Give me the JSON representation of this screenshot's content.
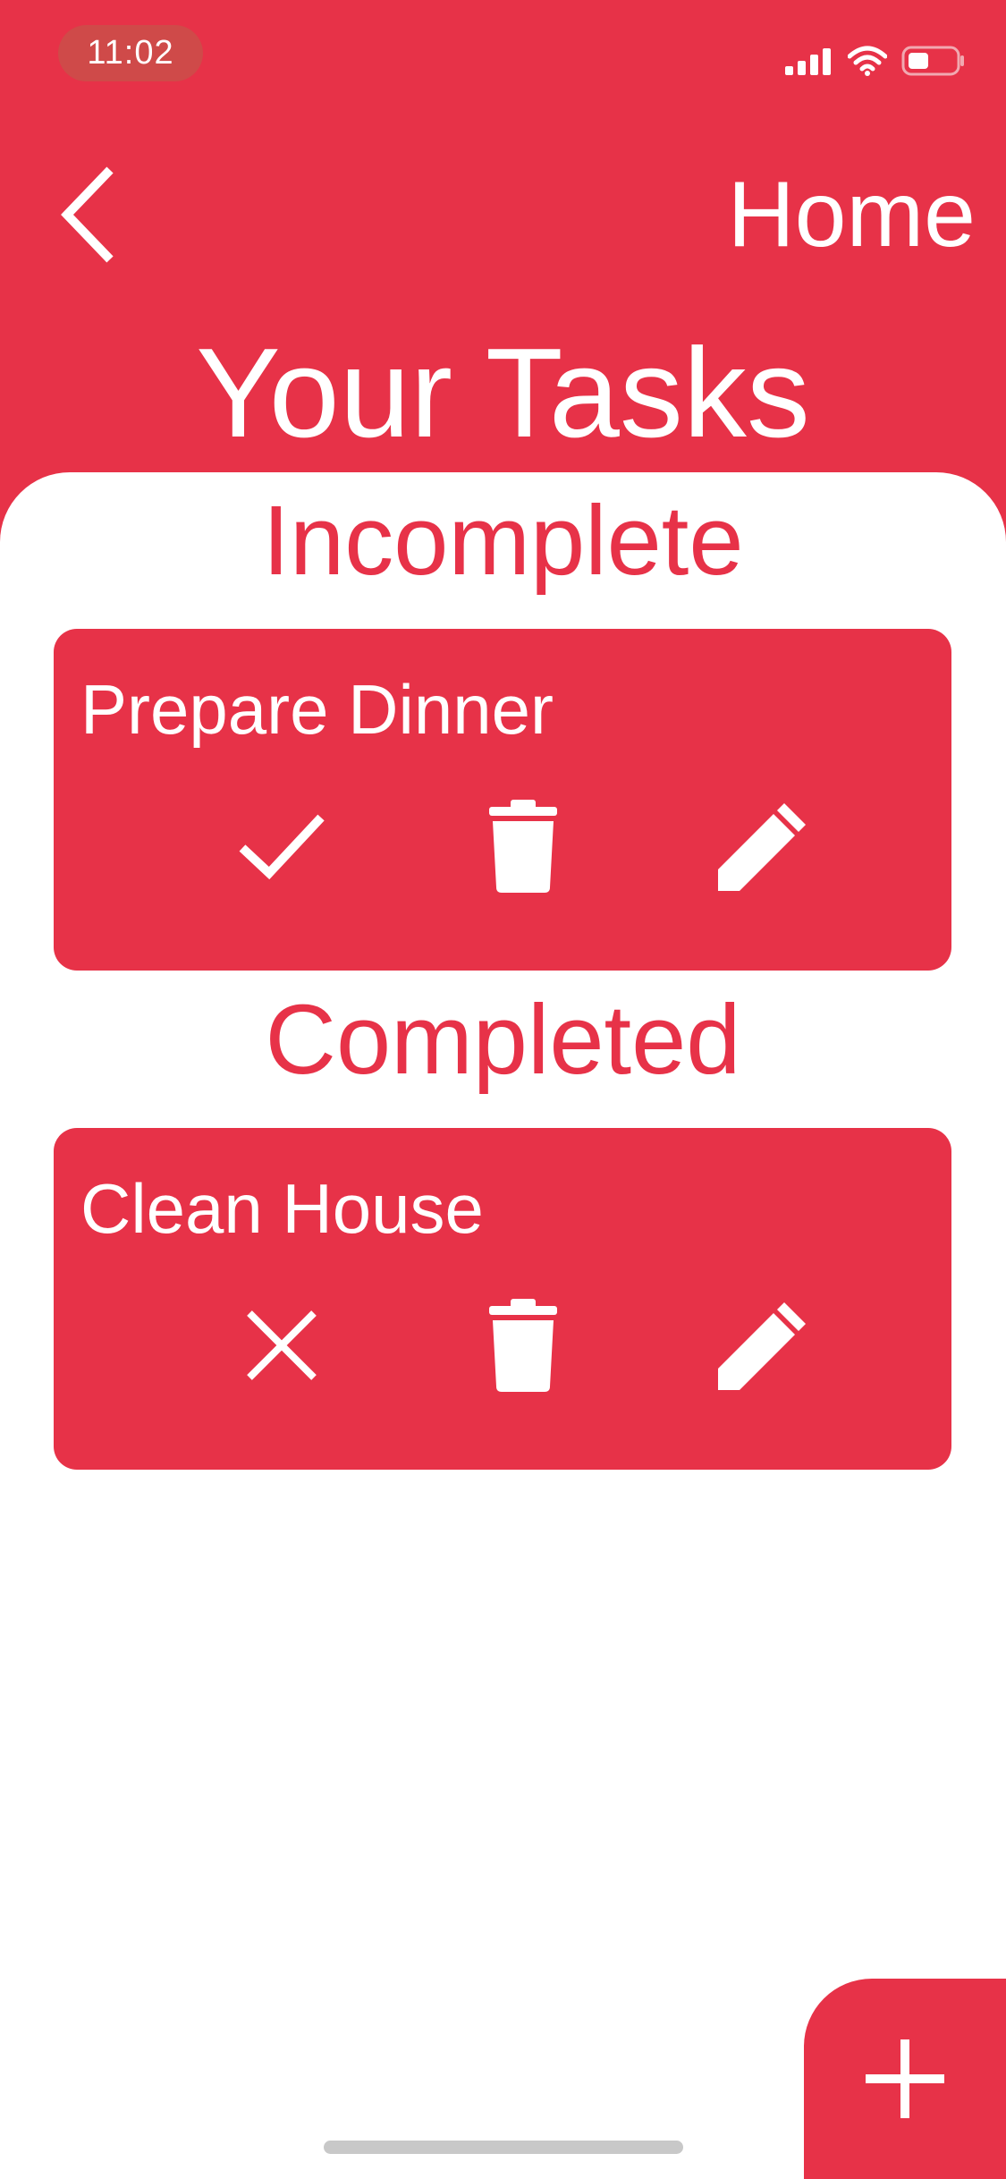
{
  "status_bar": {
    "time": "11:02",
    "icons": [
      "cellular-signal-icon",
      "wifi-icon",
      "battery-icon"
    ]
  },
  "header": {
    "back_icon": "chevron-left-icon",
    "home_label": "Home",
    "title": "Your Tasks"
  },
  "sections": {
    "incomplete": {
      "heading": "Incomplete",
      "tasks": [
        {
          "title": "Prepare Dinner",
          "actions": [
            "checkmark-icon",
            "trash-icon",
            "pencil-icon"
          ]
        }
      ]
    },
    "completed": {
      "heading": "Completed",
      "tasks": [
        {
          "title": "Clean House",
          "actions": [
            "x-icon",
            "trash-icon",
            "pencil-icon"
          ]
        }
      ]
    }
  },
  "fab": {
    "icon": "plus-icon"
  },
  "colors": {
    "accent": "#e73248",
    "background": "#ffffff",
    "text_on_accent": "#ffffff",
    "time_pill": "#cf4a49",
    "home_indicator": "#c8c8c8"
  }
}
